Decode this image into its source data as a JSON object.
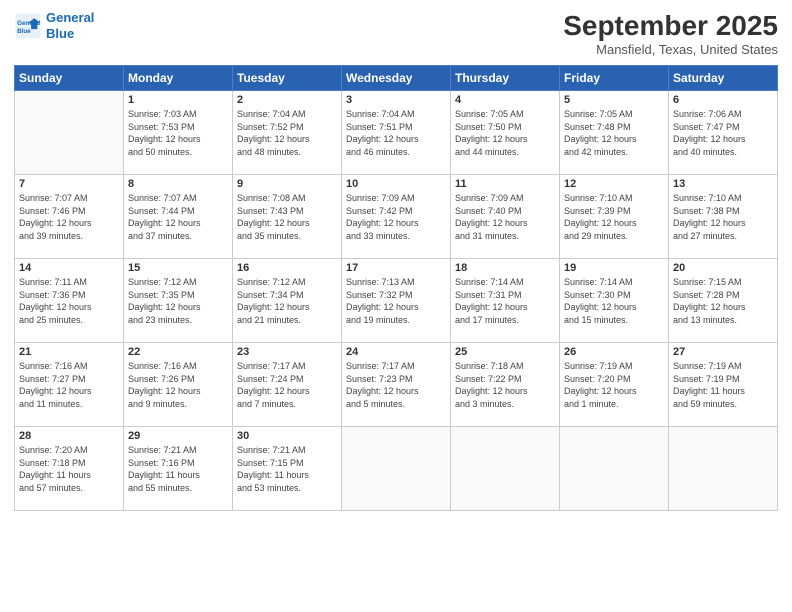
{
  "logo": {
    "line1": "General",
    "line2": "Blue"
  },
  "title": "September 2025",
  "subtitle": "Mansfield, Texas, United States",
  "days_header": [
    "Sunday",
    "Monday",
    "Tuesday",
    "Wednesday",
    "Thursday",
    "Friday",
    "Saturday"
  ],
  "weeks": [
    [
      {
        "day": "",
        "info": ""
      },
      {
        "day": "1",
        "info": "Sunrise: 7:03 AM\nSunset: 7:53 PM\nDaylight: 12 hours\nand 50 minutes."
      },
      {
        "day": "2",
        "info": "Sunrise: 7:04 AM\nSunset: 7:52 PM\nDaylight: 12 hours\nand 48 minutes."
      },
      {
        "day": "3",
        "info": "Sunrise: 7:04 AM\nSunset: 7:51 PM\nDaylight: 12 hours\nand 46 minutes."
      },
      {
        "day": "4",
        "info": "Sunrise: 7:05 AM\nSunset: 7:50 PM\nDaylight: 12 hours\nand 44 minutes."
      },
      {
        "day": "5",
        "info": "Sunrise: 7:05 AM\nSunset: 7:48 PM\nDaylight: 12 hours\nand 42 minutes."
      },
      {
        "day": "6",
        "info": "Sunrise: 7:06 AM\nSunset: 7:47 PM\nDaylight: 12 hours\nand 40 minutes."
      }
    ],
    [
      {
        "day": "7",
        "info": "Sunrise: 7:07 AM\nSunset: 7:46 PM\nDaylight: 12 hours\nand 39 minutes."
      },
      {
        "day": "8",
        "info": "Sunrise: 7:07 AM\nSunset: 7:44 PM\nDaylight: 12 hours\nand 37 minutes."
      },
      {
        "day": "9",
        "info": "Sunrise: 7:08 AM\nSunset: 7:43 PM\nDaylight: 12 hours\nand 35 minutes."
      },
      {
        "day": "10",
        "info": "Sunrise: 7:09 AM\nSunset: 7:42 PM\nDaylight: 12 hours\nand 33 minutes."
      },
      {
        "day": "11",
        "info": "Sunrise: 7:09 AM\nSunset: 7:40 PM\nDaylight: 12 hours\nand 31 minutes."
      },
      {
        "day": "12",
        "info": "Sunrise: 7:10 AM\nSunset: 7:39 PM\nDaylight: 12 hours\nand 29 minutes."
      },
      {
        "day": "13",
        "info": "Sunrise: 7:10 AM\nSunset: 7:38 PM\nDaylight: 12 hours\nand 27 minutes."
      }
    ],
    [
      {
        "day": "14",
        "info": "Sunrise: 7:11 AM\nSunset: 7:36 PM\nDaylight: 12 hours\nand 25 minutes."
      },
      {
        "day": "15",
        "info": "Sunrise: 7:12 AM\nSunset: 7:35 PM\nDaylight: 12 hours\nand 23 minutes."
      },
      {
        "day": "16",
        "info": "Sunrise: 7:12 AM\nSunset: 7:34 PM\nDaylight: 12 hours\nand 21 minutes."
      },
      {
        "day": "17",
        "info": "Sunrise: 7:13 AM\nSunset: 7:32 PM\nDaylight: 12 hours\nand 19 minutes."
      },
      {
        "day": "18",
        "info": "Sunrise: 7:14 AM\nSunset: 7:31 PM\nDaylight: 12 hours\nand 17 minutes."
      },
      {
        "day": "19",
        "info": "Sunrise: 7:14 AM\nSunset: 7:30 PM\nDaylight: 12 hours\nand 15 minutes."
      },
      {
        "day": "20",
        "info": "Sunrise: 7:15 AM\nSunset: 7:28 PM\nDaylight: 12 hours\nand 13 minutes."
      }
    ],
    [
      {
        "day": "21",
        "info": "Sunrise: 7:16 AM\nSunset: 7:27 PM\nDaylight: 12 hours\nand 11 minutes."
      },
      {
        "day": "22",
        "info": "Sunrise: 7:16 AM\nSunset: 7:26 PM\nDaylight: 12 hours\nand 9 minutes."
      },
      {
        "day": "23",
        "info": "Sunrise: 7:17 AM\nSunset: 7:24 PM\nDaylight: 12 hours\nand 7 minutes."
      },
      {
        "day": "24",
        "info": "Sunrise: 7:17 AM\nSunset: 7:23 PM\nDaylight: 12 hours\nand 5 minutes."
      },
      {
        "day": "25",
        "info": "Sunrise: 7:18 AM\nSunset: 7:22 PM\nDaylight: 12 hours\nand 3 minutes."
      },
      {
        "day": "26",
        "info": "Sunrise: 7:19 AM\nSunset: 7:20 PM\nDaylight: 12 hours\nand 1 minute."
      },
      {
        "day": "27",
        "info": "Sunrise: 7:19 AM\nSunset: 7:19 PM\nDaylight: 11 hours\nand 59 minutes."
      }
    ],
    [
      {
        "day": "28",
        "info": "Sunrise: 7:20 AM\nSunset: 7:18 PM\nDaylight: 11 hours\nand 57 minutes."
      },
      {
        "day": "29",
        "info": "Sunrise: 7:21 AM\nSunset: 7:16 PM\nDaylight: 11 hours\nand 55 minutes."
      },
      {
        "day": "30",
        "info": "Sunrise: 7:21 AM\nSunset: 7:15 PM\nDaylight: 11 hours\nand 53 minutes."
      },
      {
        "day": "",
        "info": ""
      },
      {
        "day": "",
        "info": ""
      },
      {
        "day": "",
        "info": ""
      },
      {
        "day": "",
        "info": ""
      }
    ]
  ]
}
